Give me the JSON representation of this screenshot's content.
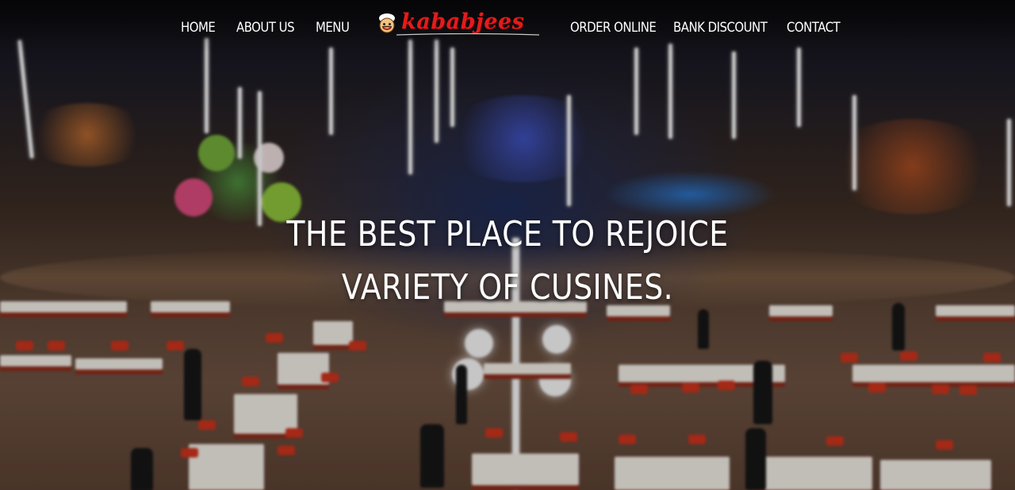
{
  "nav": {
    "left": [
      "HOME",
      "ABOUT US",
      "MENU"
    ],
    "right": [
      "ORDER ONLINE",
      "BANK DISCOUNT",
      "CONTACT"
    ]
  },
  "logo": {
    "text": "kababjees"
  },
  "hero": {
    "line1": "THE BEST PLACE TO REJOICE",
    "line2": "VARIETY OF CUSINES."
  },
  "colors": {
    "brand_red": "#e31b1b",
    "nav_text": "#ffffff"
  }
}
